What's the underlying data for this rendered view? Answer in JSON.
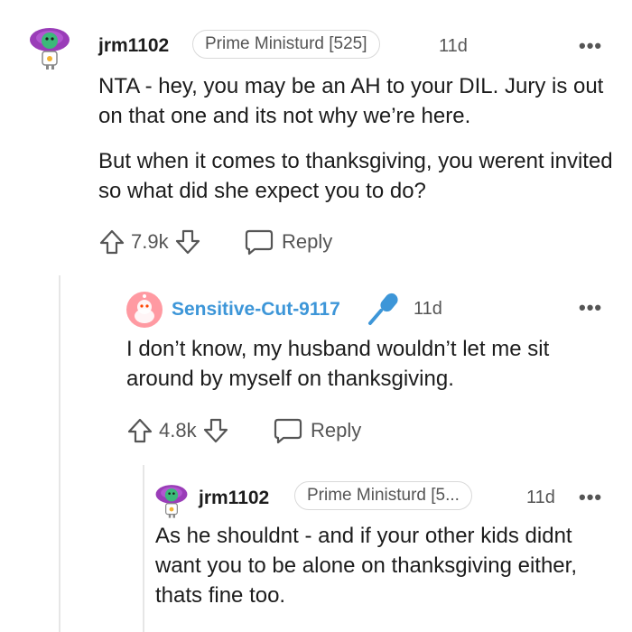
{
  "colors": {
    "text": "#1c1c1c",
    "muted": "#555555",
    "link_blue": "#3d96d8",
    "avatar_purple": "#9a3db8",
    "avatar_green": "#3cb97a",
    "avatar_pink": "#ff9aa2"
  },
  "comments": [
    {
      "username": "jrm1102",
      "flair": "Prime Ministurd [525]",
      "time": "11d",
      "more": "•••",
      "body": [
        "NTA - hey, you may be an AH to your DIL. Jury is out on that one and its not why we’re here.",
        "But when it comes to thanksgiving, you werent invited so what did she expect you to do?"
      ],
      "votes": "7.9k",
      "reply_label": "Reply"
    },
    {
      "username": "Sensitive-Cut-9117",
      "mic_icon": "microphone-icon",
      "time": "11d",
      "more": "•••",
      "body": [
        "I don’t know, my husband wouldn’t let me sit around by myself on thanksgiving."
      ],
      "votes": "4.8k",
      "reply_label": "Reply"
    },
    {
      "username": "jrm1102",
      "flair": "Prime Ministurd [5...",
      "time": "11d",
      "more": "•••",
      "body": [
        "As he shouldnt - and if your other kids didnt want you to be alone on thanksgiving either, thats fine too."
      ]
    }
  ]
}
